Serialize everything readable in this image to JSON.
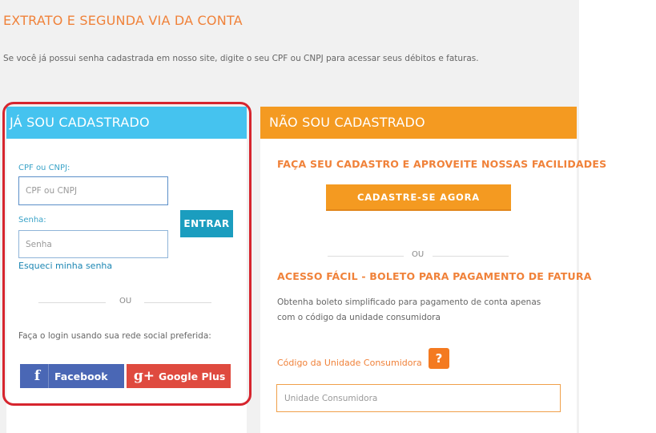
{
  "page": {
    "title": "EXTRATO E SEGUNDA VIA DA CONTA",
    "intro": "Se você já possui senha cadastrada em nosso site, digite o seu CPF ou CNPJ para acessar seus débitos e faturas."
  },
  "login": {
    "heading": "JÁ SOU CADASTRADO",
    "cpf_label": "CPF ou CNPJ:",
    "cpf_placeholder": "CPF ou CNPJ",
    "senha_label": "Senha:",
    "senha_placeholder": "Senha",
    "enter_label": "ENTRAR",
    "forgot_label": "Esqueci minha senha",
    "or_label": "OU",
    "social_text": "Faça o login usando sua rede social preferida:",
    "facebook_label": "Facebook",
    "facebook_icon": "f",
    "google_label": "Google Plus",
    "google_icon": "g+"
  },
  "register": {
    "heading": "NÃO SOU CADASTRADO",
    "subheading": "FAÇA SEU CADASTRO E APROVEITE NOSSAS FACILIDADES",
    "button_label": "CADASTRE-SE AGORA",
    "or_label": "OU",
    "boleto_heading": "ACESSO FÁCIL - BOLETO PARA PAGAMENTO DE FATURA",
    "boleto_desc": "Obtenha boleto simplificado para pagamento de conta apenas com o código da unidade consumidora",
    "uc_label": "Código da Unidade Consumidora",
    "help_icon": "?",
    "uc_placeholder": "Unidade Consumidora"
  },
  "colors": {
    "accent_orange": "#f49a21",
    "accent_blue": "#45c3ef",
    "enter_button": "#1b9dbf",
    "facebook": "#4a67b5",
    "google": "#df4a3f",
    "highlight_border": "#d6252e"
  }
}
